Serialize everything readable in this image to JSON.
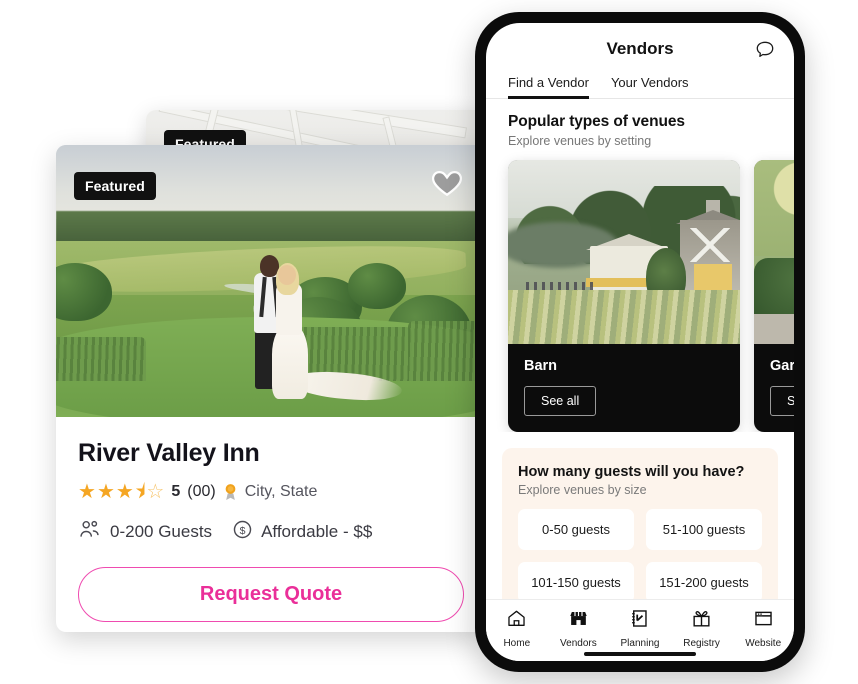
{
  "venue_card": {
    "badge": "Featured",
    "name": "River Valley Inn",
    "rating_value": 3.5,
    "rating_max": 5,
    "rating_label": "5",
    "review_count": "(00)",
    "location": "City, State",
    "capacity": "0-200 Guests",
    "price": "Affordable - $$",
    "cta": "Request Quote",
    "icons": {
      "heart": "heart-icon",
      "award": "award-rosette-icon",
      "guests": "people-icon",
      "price": "dollar-circle-icon"
    },
    "colors": {
      "cta_pink": "#ea2f99",
      "cta_border": "#ef4bb0",
      "star_gold": "#f5a623",
      "badge_bg": "#111111"
    }
  },
  "background_card": {
    "badge": "Featured"
  },
  "phone": {
    "header": {
      "title": "Vendors",
      "chat_icon": "chat-bubble-icon"
    },
    "tabs": [
      {
        "label": "Find a Vendor",
        "active": true
      },
      {
        "label": "Your Vendors",
        "active": false
      }
    ],
    "venues_section": {
      "title": "Popular types of venues",
      "subtitle": "Explore venues by setting",
      "cards": [
        {
          "name": "Barn",
          "button": "See all"
        },
        {
          "name": "Garden",
          "button": "See all"
        }
      ]
    },
    "guests_section": {
      "title": "How many guests will you have?",
      "subtitle": "Explore venues by size",
      "panel_color": "#fdf4ec",
      "options": [
        "0-50 guests",
        "51-100 guests",
        "101-150 guests",
        "151-200 guests"
      ]
    },
    "nav": [
      {
        "label": "Home",
        "icon": "home-icon",
        "active": false
      },
      {
        "label": "Vendors",
        "icon": "storefront-icon",
        "active": true
      },
      {
        "label": "Planning",
        "icon": "notebook-check-icon",
        "active": false
      },
      {
        "label": "Registry",
        "icon": "gift-icon",
        "active": false
      },
      {
        "label": "Website",
        "icon": "browser-window-icon",
        "active": false
      }
    ]
  }
}
